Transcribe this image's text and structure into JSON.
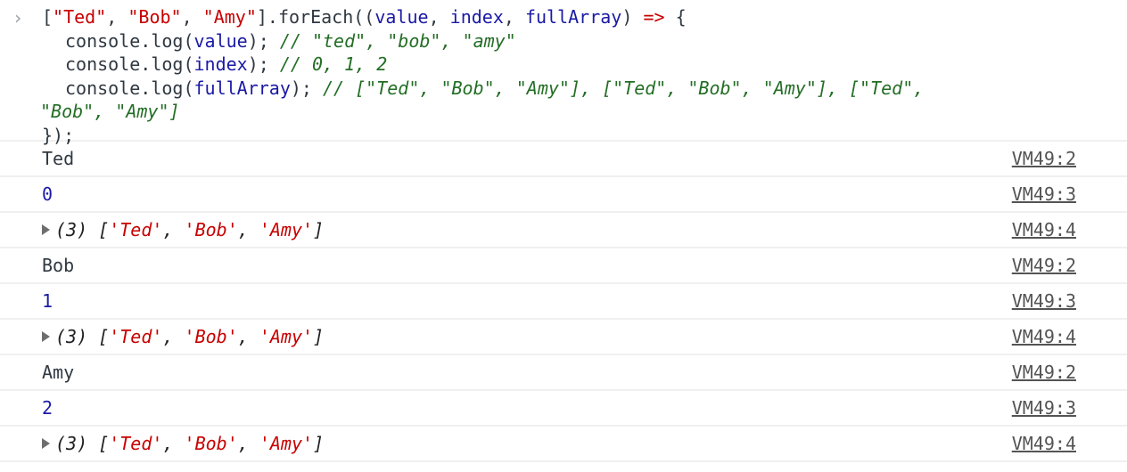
{
  "command": {
    "prompt_icon": "chevron-right-icon",
    "lines": [
      {
        "parts": [
          [
            "p",
            "["
          ],
          [
            "s",
            "\"Ted\""
          ],
          [
            "p",
            ", "
          ],
          [
            "s",
            "\"Bob\""
          ],
          [
            "p",
            ", "
          ],
          [
            "s",
            "\"Amy\""
          ],
          [
            "p",
            "].forEach(("
          ],
          [
            "v",
            "value"
          ],
          [
            "p",
            ", "
          ],
          [
            "v",
            "index"
          ],
          [
            "p",
            ", "
          ],
          [
            "v",
            "fullArray"
          ],
          [
            "p",
            ") "
          ],
          [
            "o",
            "=>"
          ],
          [
            "p",
            " {"
          ]
        ],
        "indent": false
      },
      {
        "parts": [
          [
            "p",
            "console.log("
          ],
          [
            "v",
            "value"
          ],
          [
            "p",
            "); "
          ],
          [
            "c",
            "// \"ted\", \"bob\", \"amy\""
          ]
        ],
        "indent": true
      },
      {
        "parts": [
          [
            "p",
            "console.log("
          ],
          [
            "v",
            "index"
          ],
          [
            "p",
            "); "
          ],
          [
            "c",
            "// 0, 1, 2"
          ]
        ],
        "indent": true
      },
      {
        "parts": [
          [
            "p",
            "console.log("
          ],
          [
            "v",
            "fullArray"
          ],
          [
            "p",
            "); "
          ],
          [
            "c",
            "// [\"Ted\", \"Bob\", \"Amy\"], [\"Ted\", \"Bob\", \"Amy\"], [\"Ted\","
          ]
        ],
        "indent": true
      },
      {
        "parts": [
          [
            "c",
            "\"Bob\", \"Amy\"]"
          ]
        ],
        "indent": false
      },
      {
        "parts": [
          [
            "p",
            "});"
          ]
        ],
        "indent": false
      }
    ]
  },
  "logs": [
    {
      "type": "string",
      "text": "Ted",
      "source": "VM49:2"
    },
    {
      "type": "number",
      "text": "0",
      "source": "VM49:3"
    },
    {
      "type": "array",
      "count": "(3)",
      "items": [
        "'Ted'",
        "'Bob'",
        "'Amy'"
      ],
      "source": "VM49:4"
    },
    {
      "type": "string",
      "text": "Bob",
      "source": "VM49:2"
    },
    {
      "type": "number",
      "text": "1",
      "source": "VM49:3"
    },
    {
      "type": "array",
      "count": "(3)",
      "items": [
        "'Ted'",
        "'Bob'",
        "'Amy'"
      ],
      "source": "VM49:4"
    },
    {
      "type": "string",
      "text": "Amy",
      "source": "VM49:2"
    },
    {
      "type": "number",
      "text": "2",
      "source": "VM49:3"
    },
    {
      "type": "array",
      "count": "(3)",
      "items": [
        "'Ted'",
        "'Bob'",
        "'Amy'"
      ],
      "source": "VM49:4"
    }
  ]
}
